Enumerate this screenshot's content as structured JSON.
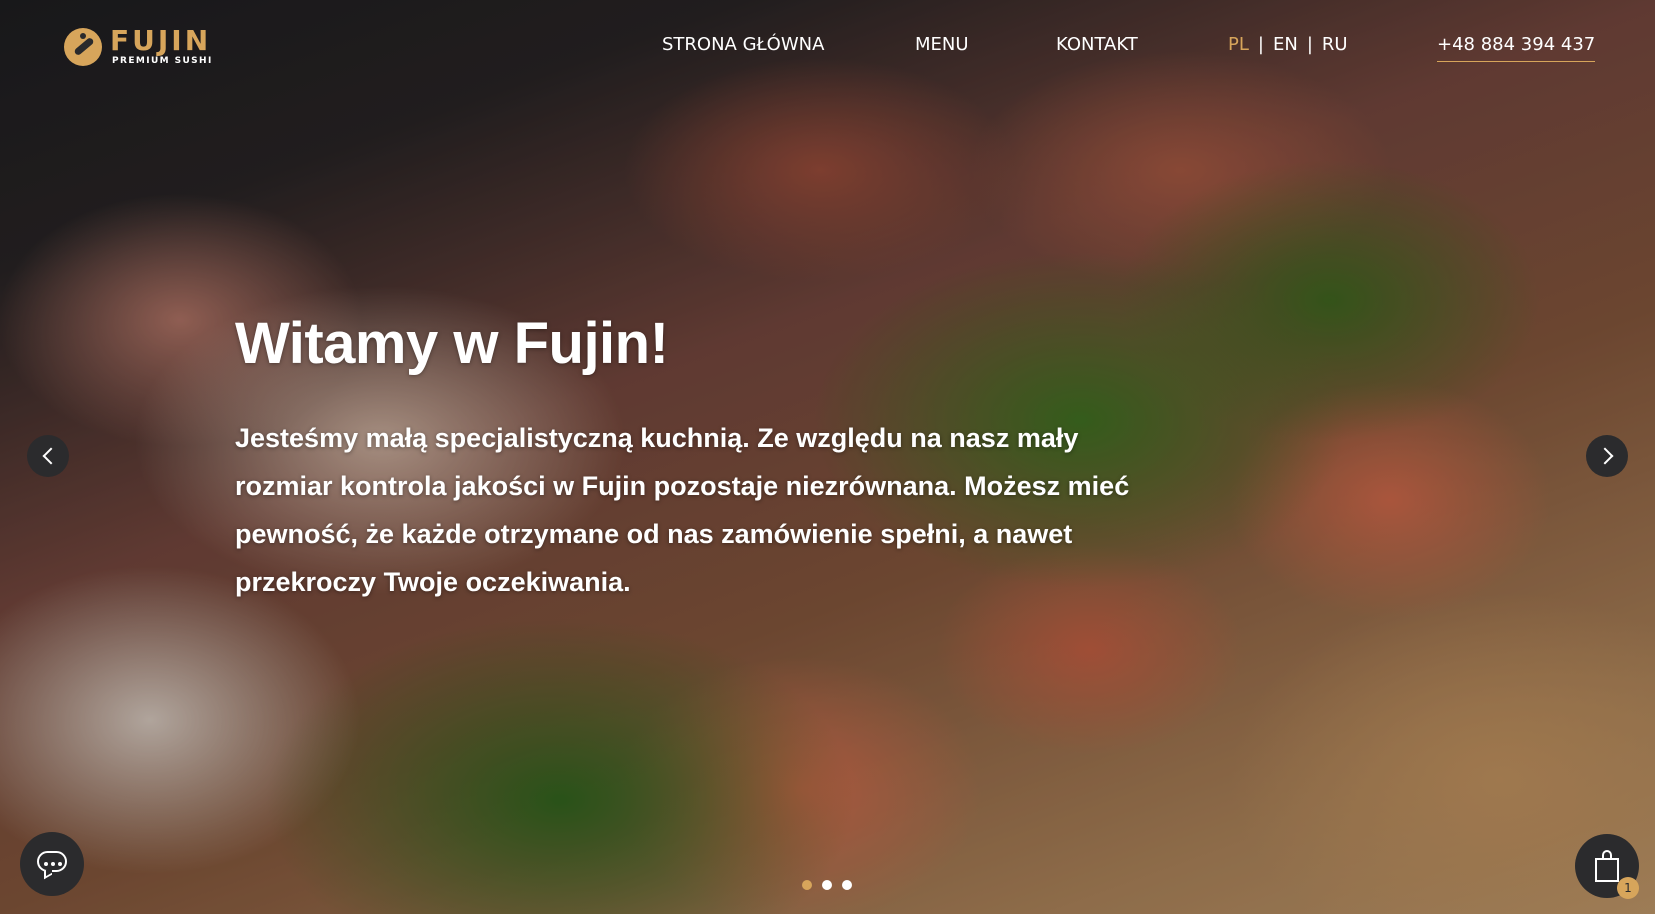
{
  "brand": {
    "name": "FUJIN",
    "tagline": "PREMIUM SUSHI",
    "accent_color": "#d7a55b"
  },
  "nav": {
    "home": "STRONA GŁÓWNA",
    "menu": "MENU",
    "contact": "KONTAKT"
  },
  "languages": {
    "items": [
      "PL",
      "EN",
      "RU"
    ],
    "active": "PL",
    "separator": "|"
  },
  "phone": "+48 884 394 437",
  "hero": {
    "title": "Witamy w Fujin!",
    "text": "Jesteśmy małą specjalistyczną kuchnią. Ze względu na nasz mały rozmiar kontrola jakości w Fujin pozostaje niezrównana. Możesz mieć pewność, że każde otrzymane od nas zamówienie spełni, a nawet przekroczy Twoje oczekiwania."
  },
  "carousel": {
    "prev_icon": "chevron-left-icon",
    "next_icon": "chevron-right-icon",
    "slide_count": 3,
    "active_slide": 1
  },
  "chat": {
    "icon": "chat-bubble-icon"
  },
  "cart": {
    "icon": "shopping-bag-icon",
    "count": "1"
  }
}
